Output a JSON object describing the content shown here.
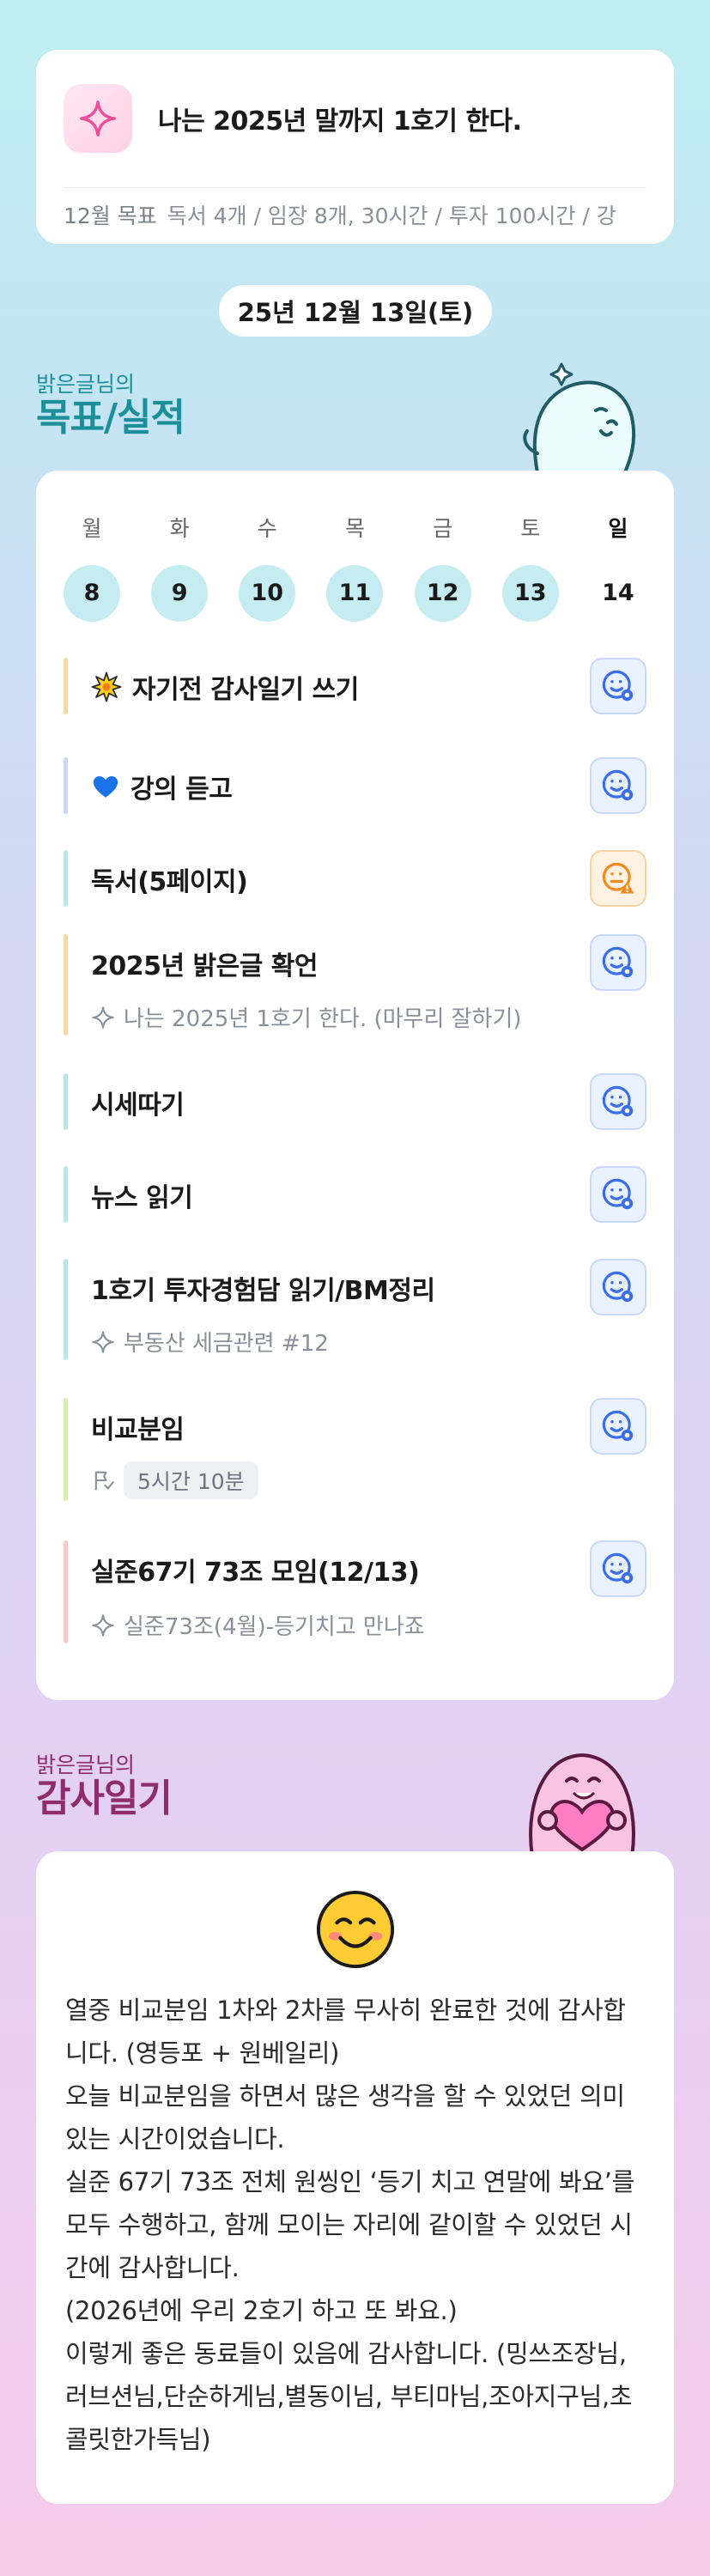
{
  "goal": {
    "title": "나는 2025년 말까지 1호기 한다.",
    "sub_label": "12월 목표",
    "sub_text": "독서 4개 / 임장 8개, 30시간 / 투자 100시간 / 강"
  },
  "date": "25년 12월 13일(토)",
  "goals_section": {
    "owner": "밝은글님의",
    "title": "목표/실적"
  },
  "week": [
    {
      "label": "월",
      "num": "8"
    },
    {
      "label": "화",
      "num": "9"
    },
    {
      "label": "수",
      "num": "10"
    },
    {
      "label": "목",
      "num": "11"
    },
    {
      "label": "금",
      "num": "12"
    },
    {
      "label": "토",
      "num": "13"
    },
    {
      "label": "일",
      "num": "14"
    }
  ],
  "tasks": [
    {
      "title": "자기전 감사일기 쓰기",
      "bar_color": "#f7d9a8",
      "status": "blue",
      "icon": "sparkle-star-emoji"
    },
    {
      "title": "강의 듣고",
      "bar_color": "#c9d8f5",
      "status": "blue",
      "icon": "blue-heart-emoji"
    },
    {
      "title": "독서(5페이지)",
      "bar_color": "#b8e6ea",
      "status": "orange"
    },
    {
      "title": "2025년 밝은글 확언",
      "sub": "나는 2025년 1호기 한다. (마무리 잘하기)",
      "bar_color": "#f7d9a8",
      "status": "blue"
    },
    {
      "title": "시세따기",
      "bar_color": "#b8e6ea",
      "status": "blue"
    },
    {
      "title": "뉴스 읽기",
      "bar_color": "#b8e6ea",
      "status": "blue"
    },
    {
      "title": "1호기 투자경험담 읽기/BM정리",
      "sub": "부동산 세금관련 #12",
      "bar_color": "#b8e6ea",
      "status": "blue"
    },
    {
      "title": "비교분임",
      "time": "5시간 10분",
      "bar_color": "#d7ecaa",
      "status": "blue"
    },
    {
      "title": "실준67기 73조 모임(12/13)",
      "sub": "실준73조(4월)-등기치고 만나죠",
      "bar_color": "#f8c9c9",
      "status": "blue"
    }
  ],
  "diary_section": {
    "owner": "밝은글님의",
    "title": "감사일기"
  },
  "diary": {
    "emoji": "smiling-face-emoji",
    "text": "열중 비교분임 1차와 2차를 무사히 완료한 것에 감사합니다. (영등포 + 원베일리)\n오늘 비교분임을 하면서 많은 생각을 할 수 있었던 의미 있는 시간이었습니다.\n실준 67기 73조 전체 원씽인 ‘등기 치고 연말에 봐요’를 모두 수행하고, 함께 모이는 자리에 같이할 수 있었던 시간에 감사합니다.\n(2026년에 우리 2호기 하고 또 봐요.)\n이렇게 좋은 동료들이 있음에 감사합니다. (밍쓰조장님,러브션님,단순하게님,별동이님, 부티마님,조아지구님,초콜릿한가득님)"
  },
  "colors": {
    "teal_title": "#1c8f98",
    "purple_title": "#8e2c6e",
    "accent_blue": "#3a6ee8",
    "accent_orange": "#f28b1e"
  }
}
